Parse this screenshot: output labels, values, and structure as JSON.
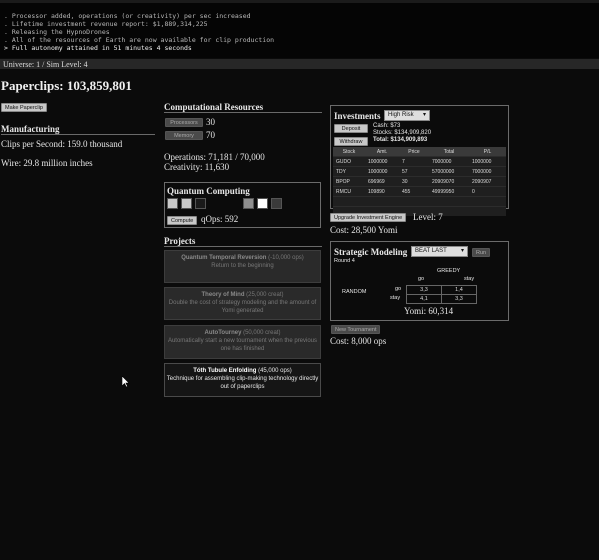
{
  "console": {
    "lines": [
      ". Processor added, operations (or creativity) per sec increased",
      ". Lifetime investment revenue report: $1,889,314,225",
      ". Releasing the HypnoDrones",
      ". All of the resources of Earth are now available for clip production",
      "> Full autonomy attained in 51 minutes 4 seconds"
    ]
  },
  "universe": "Universe: 1 / Sim Level: 4",
  "paperclips": {
    "label": "Paperclips: 103,859,801"
  },
  "make_paperclip_button": "Make Paperclip",
  "manufacturing": {
    "heading": "Manufacturing",
    "clips_per_second": "Clips per Second: 159.0 thousand",
    "wire": "Wire: 29.8 million inches"
  },
  "computational": {
    "heading": "Computational Resources",
    "processors_label": "Processors",
    "processors_value": "30",
    "memory_label": "Memory",
    "memory_value": "70",
    "operations": "Operations: 71,181 / 70,000",
    "creativity": "Creativity: 11,630"
  },
  "quantum": {
    "heading": "Quantum Computing",
    "compute_button": "Compute",
    "qops": "qOps: 592",
    "chips": [
      "#c9c9c9",
      "#c9c9c9",
      "#1a1a1a",
      "#8f8f8f",
      "#ffffff",
      "#3a3a3a"
    ]
  },
  "projects": {
    "heading": "Projects",
    "items": [
      {
        "name": "Quantum Temporal Reversion",
        "cost": " (-10,000 ops)",
        "desc": "Return to the beginning",
        "available": false
      },
      {
        "name": "Theory of Mind",
        "cost": " (25,000 creat)",
        "desc": "Double the cost of strategy modeling and the amount of Yomi generated",
        "available": false
      },
      {
        "name": "AutoTourney",
        "cost": " (50,000 creat)",
        "desc": "Automatically start a new tournament when the previous one has finished",
        "available": false
      },
      {
        "name": "Tóth Tubule Enfolding",
        "cost": " (45,000 ops)",
        "desc": "Technique for assembling clip-making technology directly out of paperclips",
        "available": true
      }
    ]
  },
  "investments": {
    "heading": "Investments",
    "risk": "High Risk",
    "deposit_button": "Deposit",
    "withdraw_button": "Withdraw",
    "cash": "Cash: $73",
    "stocks": "Stocks: $134,909,820",
    "total": "Total: $134,909,893",
    "columns": [
      "Stock",
      "Amt.",
      "Price",
      "Total",
      "P/L"
    ],
    "rows": [
      [
        "GUDO",
        "1000000",
        "7",
        "7000000",
        "1000000"
      ],
      [
        "TDY",
        "1000000",
        "57",
        "57000000",
        "7000000"
      ],
      [
        "BPOP",
        "696969",
        "30",
        "20909070",
        "2090907"
      ],
      [
        "RMCU",
        "109890",
        "455",
        "49999950",
        "0"
      ],
      [
        "",
        "",
        "",
        "",
        ""
      ],
      [
        "",
        "",
        "",
        "",
        ""
      ]
    ],
    "upgrade_button": "Upgrade Investment Engine",
    "level": "Level: 7",
    "cost": "Cost: 28,500 Yomi"
  },
  "strategic": {
    "heading": "Strategic Modeling",
    "strategy": "BEAT LAST",
    "run_button": "Run",
    "round": "Round 4",
    "opponent": "GREEDY",
    "player": "RANDOM",
    "cols": [
      "go",
      "stay"
    ],
    "rows": [
      {
        "label": "go",
        "cells": [
          "3,3",
          "1,4"
        ]
      },
      {
        "label": "stay",
        "cells": [
          "4,1",
          "3,3"
        ]
      }
    ],
    "yomi": "Yomi: 60,314",
    "new_tournament_button": "New Tournament",
    "cost": "Cost: 8,000 ops"
  }
}
